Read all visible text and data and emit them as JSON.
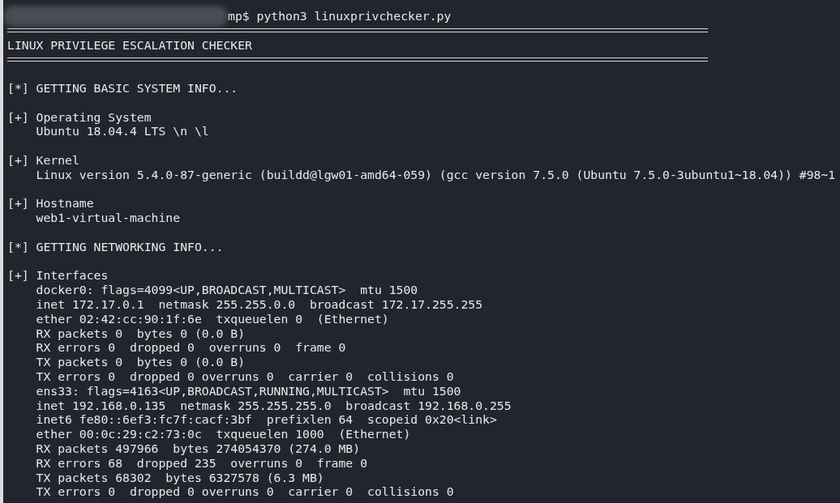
{
  "command": {
    "redacted": true,
    "text": "mp$ python3 linuxprivchecker.py"
  },
  "lines": [
    {
      "kind": "rule"
    },
    {
      "kind": "text",
      "text": "LINUX PRIVILEGE ESCALATION CHECKER"
    },
    {
      "kind": "rule"
    },
    {
      "kind": "blank"
    },
    {
      "kind": "text",
      "text": "[*] GETTING BASIC SYSTEM INFO..."
    },
    {
      "kind": "blank"
    },
    {
      "kind": "text",
      "text": "[+] Operating System"
    },
    {
      "kind": "text",
      "text": "    Ubuntu 18.04.4 LTS \\n \\l"
    },
    {
      "kind": "blank"
    },
    {
      "kind": "text",
      "text": "[+] Kernel"
    },
    {
      "kind": "text",
      "text": "    Linux version 5.4.0-87-generic (buildd@lgw01-amd64-059) (gcc version 7.5.0 (Ubuntu 7.5.0-3ubuntu1~18.04)) #98~1"
    },
    {
      "kind": "blank"
    },
    {
      "kind": "text",
      "text": "[+] Hostname"
    },
    {
      "kind": "text",
      "text": "    web1-virtual-machine"
    },
    {
      "kind": "blank"
    },
    {
      "kind": "text",
      "text": "[*] GETTING NETWORKING INFO..."
    },
    {
      "kind": "blank"
    },
    {
      "kind": "text",
      "text": "[+] Interfaces"
    },
    {
      "kind": "text",
      "text": "    docker0: flags=4099<UP,BROADCAST,MULTICAST>  mtu 1500"
    },
    {
      "kind": "text",
      "text": "    inet 172.17.0.1  netmask 255.255.0.0  broadcast 172.17.255.255"
    },
    {
      "kind": "text",
      "text": "    ether 02:42:cc:90:1f:6e  txqueuelen 0  (Ethernet)"
    },
    {
      "kind": "text",
      "text": "    RX packets 0  bytes 0 (0.0 B)"
    },
    {
      "kind": "text",
      "text": "    RX errors 0  dropped 0  overruns 0  frame 0"
    },
    {
      "kind": "text",
      "text": "    TX packets 0  bytes 0 (0.0 B)"
    },
    {
      "kind": "text",
      "text": "    TX errors 0  dropped 0 overruns 0  carrier 0  collisions 0"
    },
    {
      "kind": "text",
      "text": "    ens33: flags=4163<UP,BROADCAST,RUNNING,MULTICAST>  mtu 1500"
    },
    {
      "kind": "text",
      "text": "    inet 192.168.0.135  netmask 255.255.255.0  broadcast 192.168.0.255"
    },
    {
      "kind": "text",
      "text": "    inet6 fe80::6ef3:fc7f:cacf:3bf  prefixlen 64  scopeid 0x20<link>"
    },
    {
      "kind": "text",
      "text": "    ether 00:0c:29:c2:73:0c  txqueuelen 1000  (Ethernet)"
    },
    {
      "kind": "text",
      "text": "    RX packets 497966  bytes 274054370 (274.0 MB)"
    },
    {
      "kind": "text",
      "text": "    RX errors 68  dropped 235  overruns 0  frame 0"
    },
    {
      "kind": "text",
      "text": "    TX packets 68302  bytes 6327578 (6.3 MB)"
    },
    {
      "kind": "text",
      "text": "    TX errors 0  dropped 0 overruns 0  carrier 0  collisions 0"
    }
  ]
}
